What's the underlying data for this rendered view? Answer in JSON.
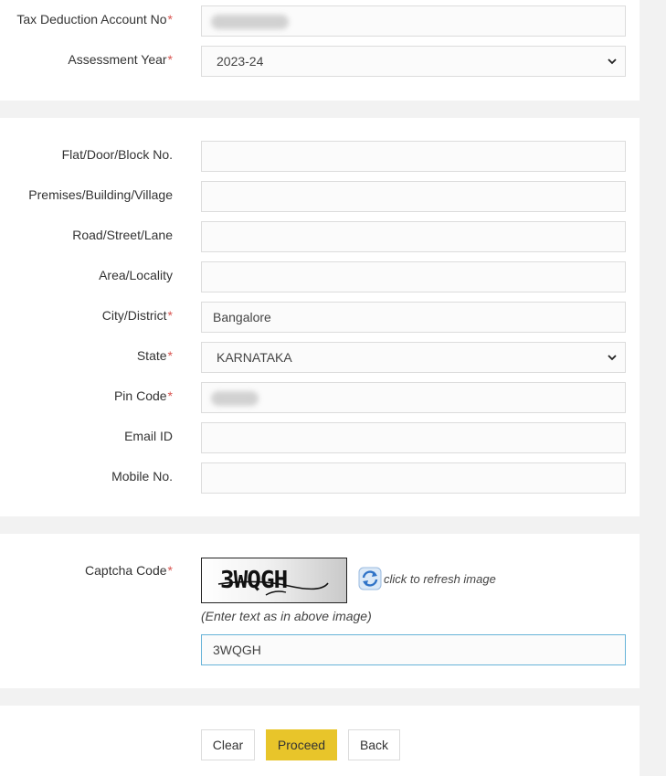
{
  "tan_section": {
    "tan_label": "Tax Deduction Account No",
    "tan_value": "",
    "assessment_year_label": "Assessment Year",
    "assessment_year_value": "2023-24"
  },
  "address_section": {
    "flat_label": "Flat/Door/Block No.",
    "flat_value": "",
    "premises_label": "Premises/Building/Village",
    "premises_value": "",
    "road_label": "Road/Street/Lane",
    "road_value": "",
    "area_label": "Area/Locality",
    "area_value": "",
    "city_label": "City/District",
    "city_value": "Bangalore",
    "state_label": "State",
    "state_value": "KARNATAKA",
    "pin_label": "Pin Code",
    "pin_value": "",
    "email_label": "Email ID",
    "email_value": "",
    "mobile_label": "Mobile No.",
    "mobile_value": ""
  },
  "captcha_section": {
    "captcha_label": "Captcha Code",
    "captcha_image_text": "3WQGH",
    "refresh_label": "click to refresh image",
    "hint": "(Enter text as in above image)",
    "captcha_input_value": "3WQGH"
  },
  "actions": {
    "clear_label": "Clear",
    "proceed_label": "Proceed",
    "back_label": "Back"
  },
  "required_marker": "*",
  "colors": {
    "required": "#d9534f",
    "proceed_button": "#e8c52a",
    "captcha_focus_border": "#66b3d8",
    "page_background": "#f2f2f2"
  }
}
